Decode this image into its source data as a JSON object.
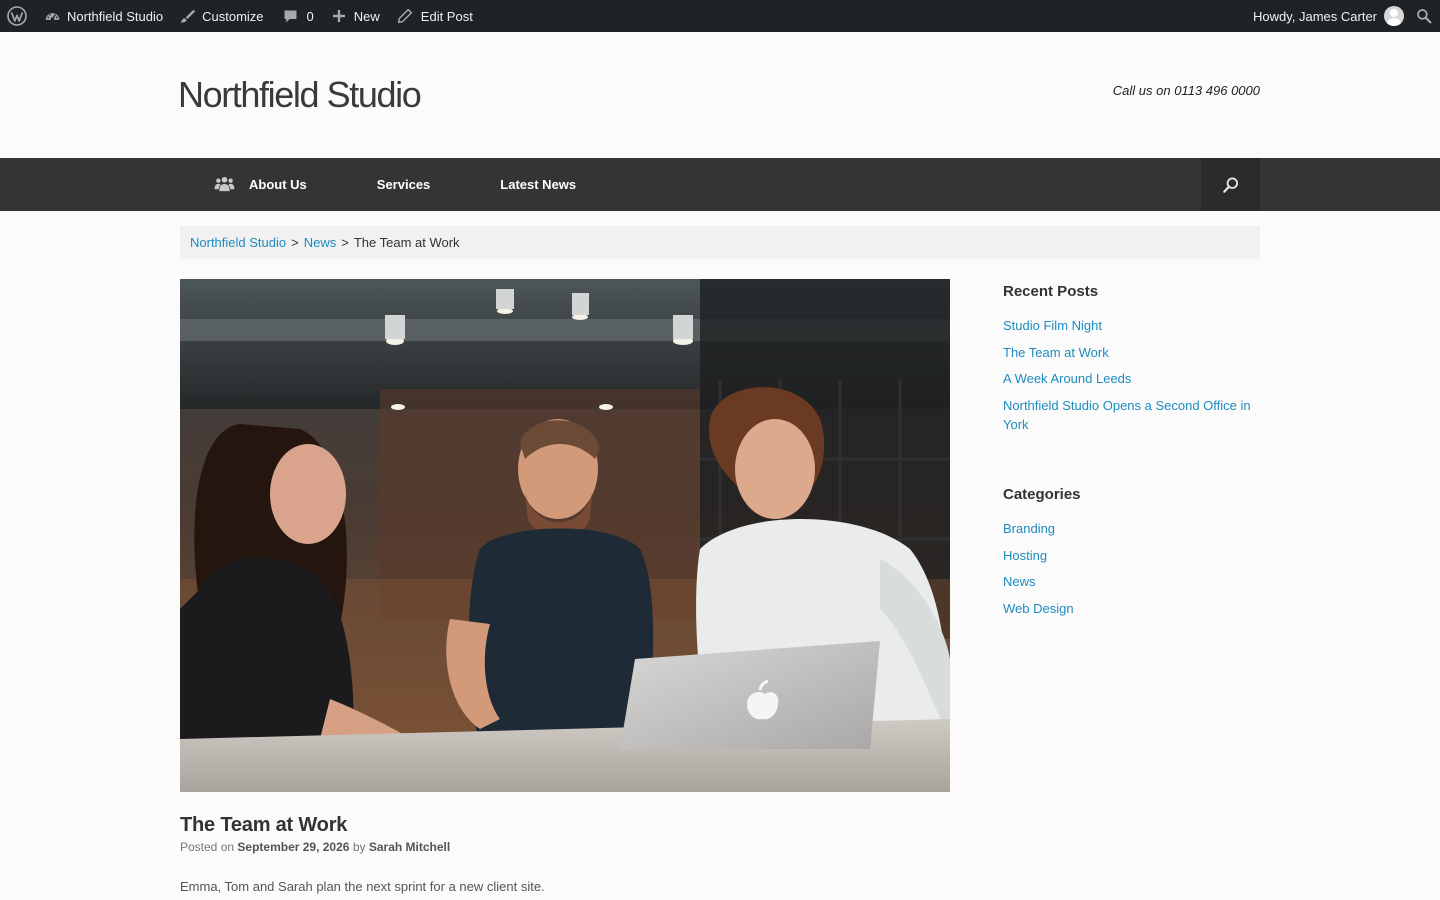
{
  "admin_bar": {
    "site_name": "Northfield Studio",
    "customize": "Customize",
    "comments_count": "0",
    "new": "New",
    "edit_post": "Edit Post",
    "greeting": "Howdy, James Carter"
  },
  "header": {
    "site_title": "Northfield Studio",
    "phone": "Call us on 0113 496 0000"
  },
  "nav": {
    "items": [
      {
        "label": "About Us",
        "icon": "team-icon"
      },
      {
        "label": "Services"
      },
      {
        "label": "Latest News"
      }
    ]
  },
  "breadcrumb": {
    "home": "Northfield Studio",
    "separator": ">",
    "section": "News",
    "current": "The Team at Work"
  },
  "post": {
    "title": "The Team at Work",
    "posted_on_label": "Posted on",
    "date": "September 29, 2026",
    "by_label": "by",
    "author": "Sarah Mitchell",
    "excerpt": "Emma, Tom and Sarah plan the next sprint for a new client site."
  },
  "sidebar": {
    "recent_posts": {
      "title": "Recent Posts",
      "items": [
        "Studio Film Night",
        "The Team at Work",
        "A Week Around Leeds",
        "Northfield Studio Opens a Second Office in York"
      ]
    },
    "categories": {
      "title": "Categories",
      "items": [
        "Branding",
        "Hosting",
        "News",
        "Web Design"
      ]
    }
  },
  "colors": {
    "admin_bar": "#1d2327",
    "nav_bar": "#333436",
    "link": "#1e8cbe"
  }
}
